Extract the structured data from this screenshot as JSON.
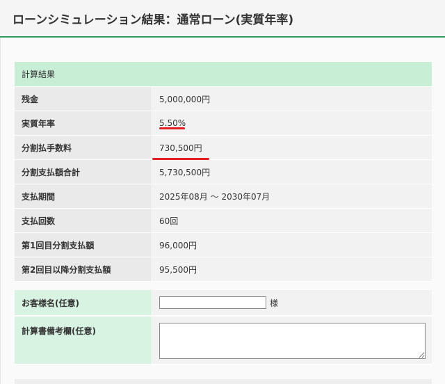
{
  "page": {
    "title": "ローンシミュレーション結果：通常ローン(実質年率)"
  },
  "result": {
    "header": "計算結果",
    "rows": [
      {
        "label": "残金",
        "value": "5,000,000円"
      },
      {
        "label": "実質年率",
        "value": "5.50%"
      },
      {
        "label": "分割払手数料",
        "value": "730,500円"
      },
      {
        "label": "分割支払額合計",
        "value": "5,730,500円"
      },
      {
        "label": "支払期間",
        "value": "2025年08月 ～ 2030年07月"
      },
      {
        "label": "支払回数",
        "value": "60回"
      },
      {
        "label": "第1回目分割支払額",
        "value": "96,000円"
      },
      {
        "label": "第2回目以降分割支払額",
        "value": "95,500円"
      }
    ]
  },
  "form": {
    "customer_name": {
      "label": "お客様名(任意)",
      "value": "",
      "suffix": "様"
    },
    "remarks": {
      "label": "計算書備考欄(任意)",
      "value": ""
    }
  },
  "colors": {
    "accent_green": "#2f9e5a",
    "header_row_bg": "#c9eed6",
    "form_label_bg": "#d9f3e2",
    "annotation_red": "#e21d23"
  }
}
